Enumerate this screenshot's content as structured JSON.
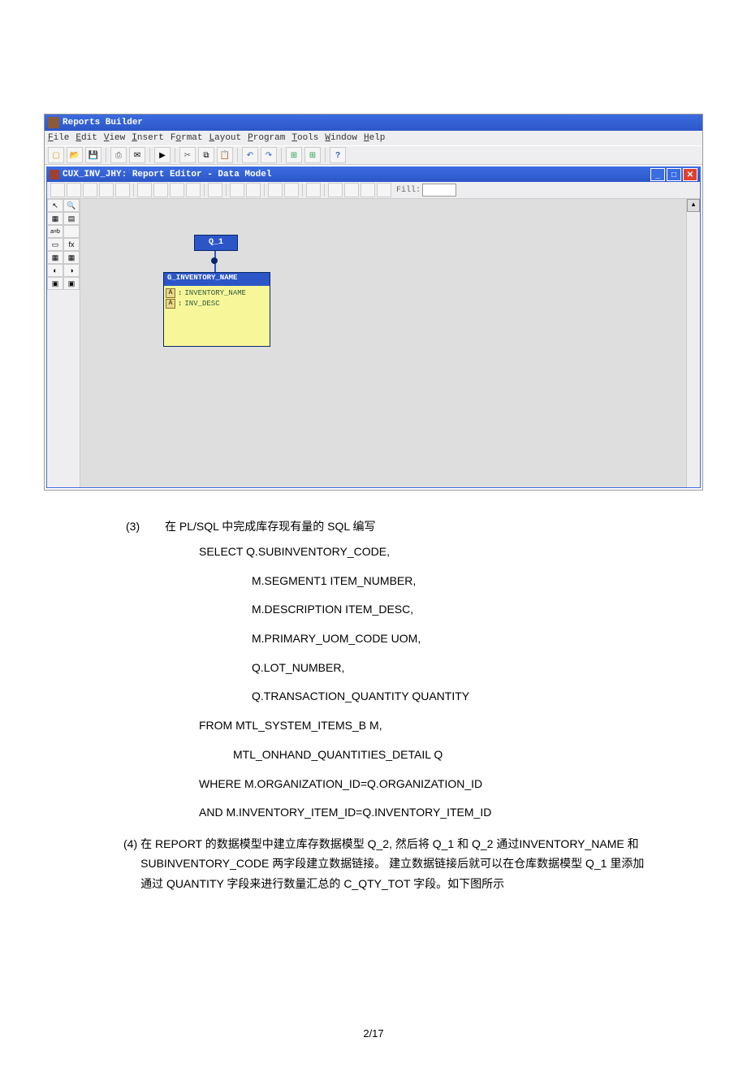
{
  "app": {
    "title": "Reports Builder",
    "menus": [
      "File",
      "Edit",
      "View",
      "Insert",
      "Format",
      "Layout",
      "Program",
      "Tools",
      "Window",
      "Help"
    ]
  },
  "inner": {
    "title": "CUX_INV_JHY: Report Editor - Data Model",
    "fill_label": "Fill:"
  },
  "model": {
    "query_name": "Q_1",
    "group_name": "G_INVENTORY_NAME",
    "fields": [
      "INVENTORY_NAME",
      "INV_DESC"
    ]
  },
  "doc": {
    "item3_num": "(3)",
    "item3_text": "在 PL/SQL  中完成库存现有量的  SQL 编写",
    "sql": [
      "SELECT Q.SUBINVENTORY_CODE,",
      "M.SEGMENT1 ITEM_NUMBER,",
      "M.DESCRIPTION ITEM_DESC,",
      "M.PRIMARY_UOM_CODE UOM,",
      "Q.LOT_NUMBER,",
      "Q.TRANSACTION_QUANTITY QUANTITY",
      "FROM MTL_SYSTEM_ITEMS_B M,",
      "MTL_ONHAND_QUANTITIES_DETAIL Q",
      "WHERE M.ORGANIZATION_ID=Q.ORGANIZATION_ID",
      "AND       M.INVENTORY_ITEM_ID=Q.INVENTORY_ITEM_ID"
    ],
    "item4_num": "(4) ",
    "item4_text": "在 REPORT 的数据模型中建立库存数据模型     Q_2, 然后将 Q_1 和 Q_2 通过INVENTORY_NAME     和 SUBINVENTORY_CODE   两字段建立数据链接。    建立数据链接后就可以在仓库数据模型    Q_1 里添加通过 QUANTITY     字段来进行数量汇总的 C_QTY_TOT 字段。如下图所示",
    "page_number": "2/17"
  }
}
